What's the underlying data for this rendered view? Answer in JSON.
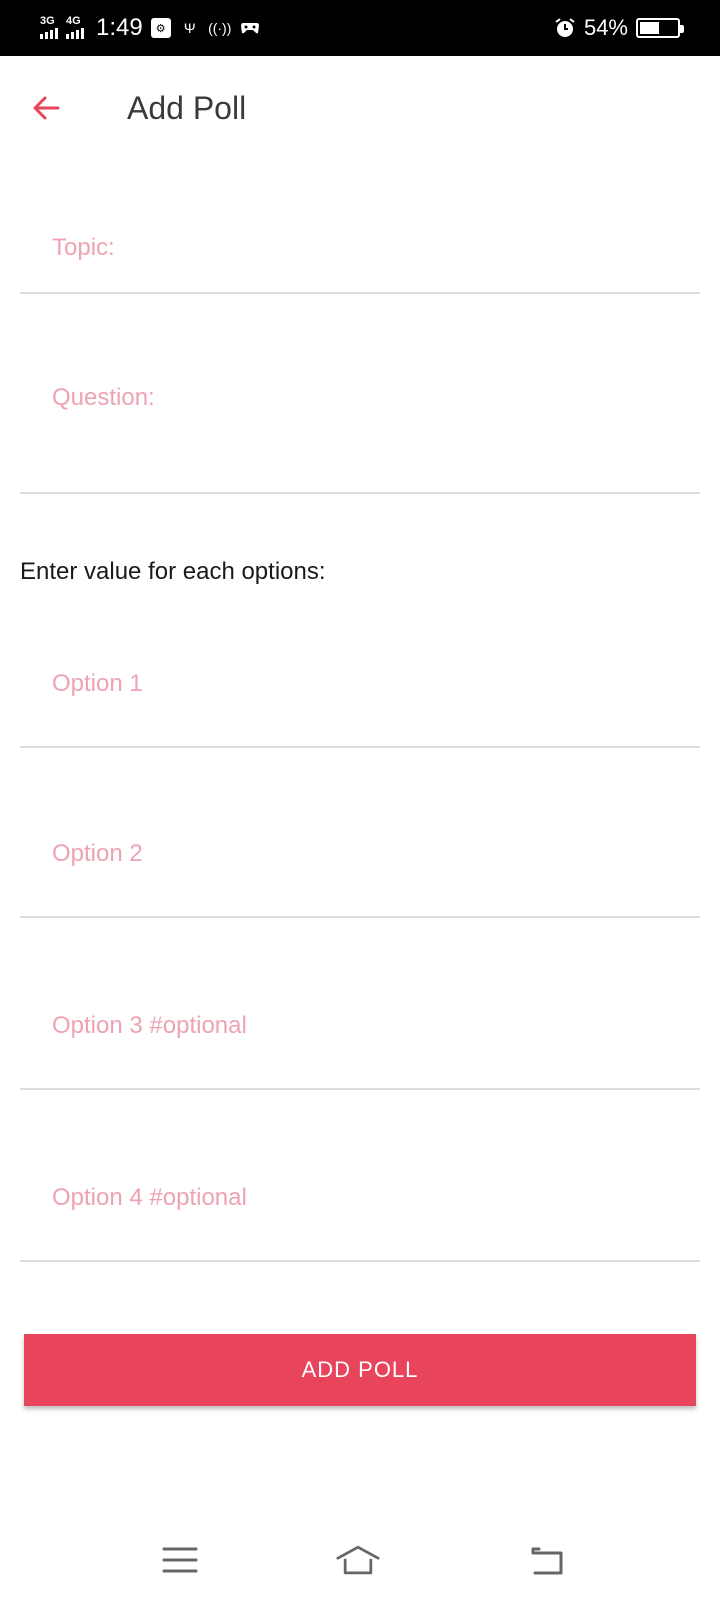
{
  "status_bar": {
    "net1": "3G",
    "net2": "4G",
    "time": "1:49",
    "battery": "54%",
    "battery_level": 0.54,
    "icons": [
      "usb-debug-icon",
      "usb-icon",
      "hotspot-icon",
      "game-icon",
      "alarm-icon",
      "battery-charging-icon"
    ]
  },
  "appbar": {
    "title": "Add Poll",
    "back_icon": "arrow-left-icon"
  },
  "form": {
    "topic_placeholder": "Topic:",
    "question_placeholder": "Question:",
    "options_label": "Enter value for each options:",
    "option1_placeholder": "Option 1",
    "option2_placeholder": "Option 2",
    "option3_placeholder": "Option 3 #optional",
    "option4_placeholder": "Option 4 #optional",
    "submit_label": "ADD POLL"
  },
  "colors": {
    "accent": "#e8455d",
    "placeholder": "#eea3b2",
    "divider": "#dcdcdc"
  },
  "navbar": {
    "icons": [
      "menu-icon",
      "home-icon",
      "back-icon"
    ]
  }
}
